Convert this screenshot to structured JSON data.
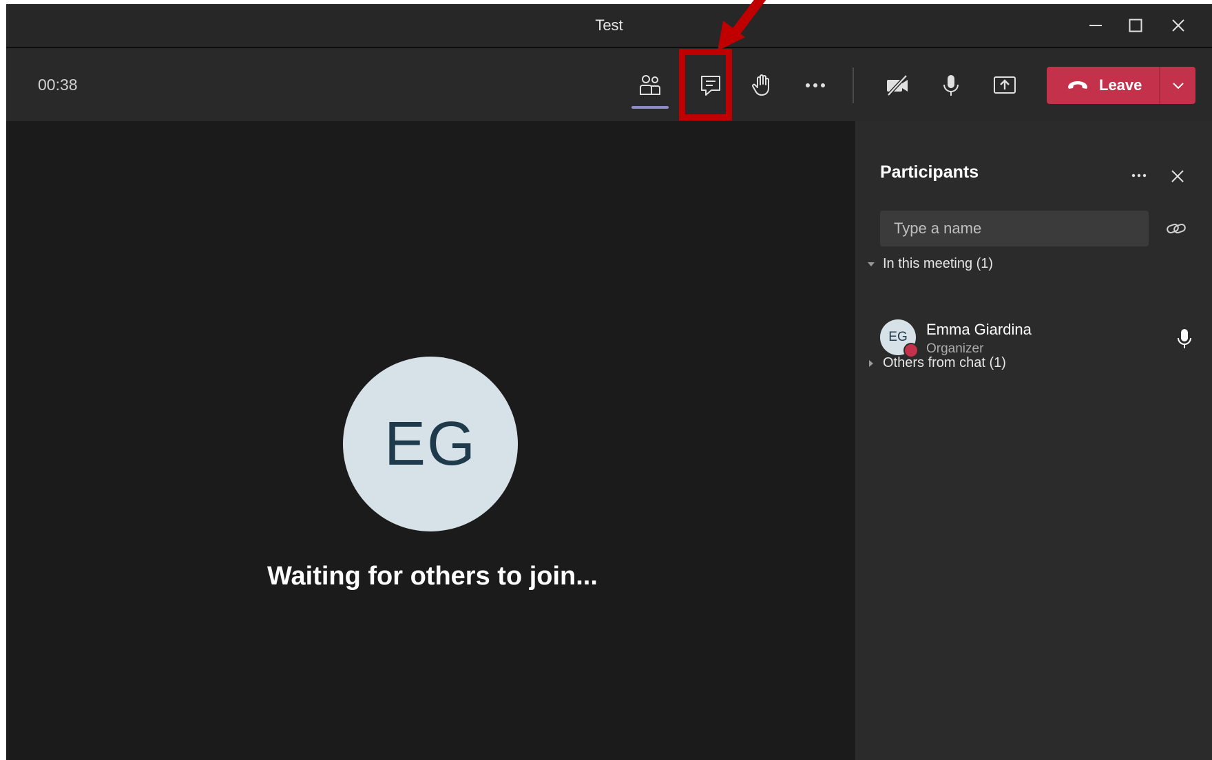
{
  "window": {
    "title": "Test"
  },
  "toolbar": {
    "timer": "00:38",
    "leave_label": "Leave"
  },
  "stage": {
    "avatar_initials": "EG",
    "status_text": "Waiting for others to join..."
  },
  "panel": {
    "title": "Participants",
    "search_placeholder": "Type a name",
    "sections": [
      {
        "label": "In this meeting (1)",
        "expanded": true
      },
      {
        "label": "Others from chat (1)",
        "expanded": false
      }
    ],
    "participants": [
      {
        "initials": "EG",
        "name": "Emma Giardina",
        "role": "Organizer"
      }
    ]
  },
  "icons": {
    "titlebar": [
      "minimize-icon",
      "maximize-icon",
      "close-icon"
    ],
    "toolbar": [
      "participants-icon",
      "chat-icon",
      "raise-hand-icon",
      "more-icon",
      "camera-off-icon",
      "microphone-icon",
      "share-screen-icon",
      "hang-up-icon",
      "chevron-down-icon"
    ],
    "panel": [
      "more-icon",
      "close-icon",
      "link-icon",
      "caret-down-icon",
      "caret-right-icon",
      "microphone-icon"
    ]
  },
  "colors": {
    "leave_button": "#c4314b",
    "active_indicator": "#8b8cc7",
    "annotation": "#c00000",
    "avatar_bg": "#d7e2e8",
    "avatar_text": "#1f3a4b"
  }
}
